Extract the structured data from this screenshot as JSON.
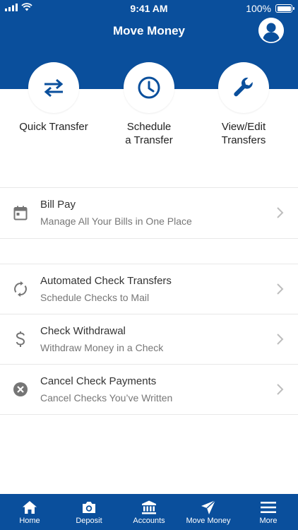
{
  "status_bar": {
    "time": "9:41 AM",
    "battery": "100%"
  },
  "header": {
    "title": "Move Money",
    "profile_icon": "user-circle-icon"
  },
  "quick_actions": [
    {
      "label": "Quick Transfer",
      "icon": "swap-arrows-icon"
    },
    {
      "label": "Schedule\na Transfer",
      "icon": "clock-icon"
    },
    {
      "label": "View/Edit\nTransfers",
      "icon": "wrench-icon"
    }
  ],
  "bill_pay": {
    "title": "Bill Pay",
    "subtitle": "Manage All Your Bills in One Place",
    "icon": "calendar-icon"
  },
  "check_items": [
    {
      "title": "Automated Check Transfers",
      "subtitle": "Schedule Checks to Mail",
      "icon": "refresh-icon"
    },
    {
      "title": "Check Withdrawal",
      "subtitle": "Withdraw Money in a Check",
      "icon": "dollar-icon"
    },
    {
      "title": "Cancel Check Payments",
      "subtitle": "Cancel Checks You’ve Written",
      "icon": "cancel-circle-icon"
    }
  ],
  "tabs": [
    {
      "label": "Home",
      "icon": "home-icon"
    },
    {
      "label": "Deposit",
      "icon": "camera-icon"
    },
    {
      "label": "Accounts",
      "icon": "bank-icon"
    },
    {
      "label": "Move Money",
      "icon": "send-icon",
      "active": true
    },
    {
      "label": "More",
      "icon": "menu-icon"
    }
  ],
  "colors": {
    "brand_blue": "#0a4f9c",
    "icon_gray": "#757575",
    "chevron_gray": "#bdbdbd"
  }
}
